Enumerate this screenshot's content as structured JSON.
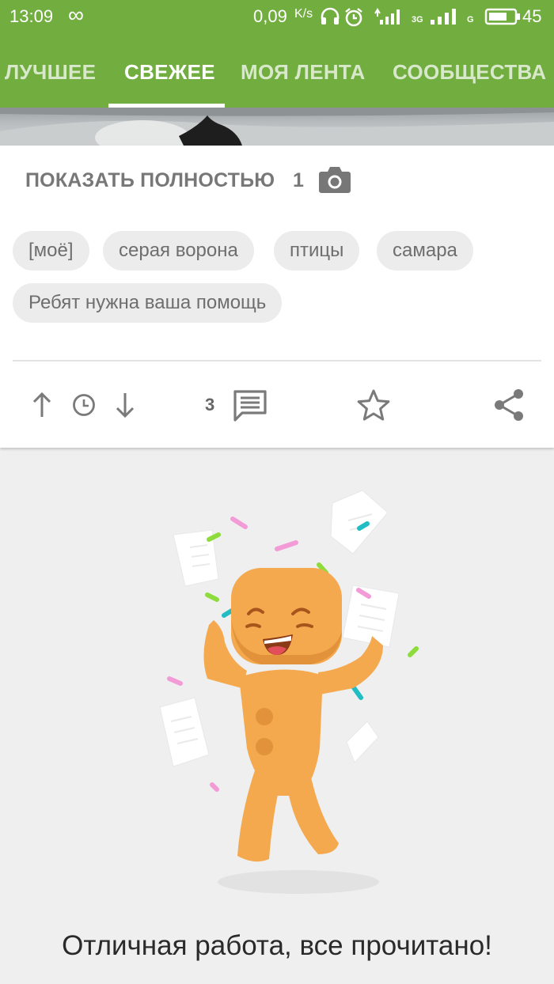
{
  "status_bar": {
    "time": "13:09",
    "loop_symbol": "∞",
    "net_speed": "0,09",
    "net_speed_unit": "K/s",
    "network_3g": "3G",
    "network_g": "G",
    "battery": "45"
  },
  "tabs": [
    {
      "label": "ЛУЧШЕЕ",
      "active": false
    },
    {
      "label": "СВЕЖЕЕ",
      "active": true
    },
    {
      "label": "МОЯ ЛЕНТА",
      "active": false
    },
    {
      "label": "СООБЩЕСТВА",
      "active": false
    }
  ],
  "post": {
    "show_full_label": "ПОКАЗАТЬ ПОЛНОСТЬЮ",
    "photo_count": "1",
    "tags": [
      "[моё]",
      "серая ворона",
      "птицы",
      "самара",
      "Ребят нужна ваша помощь"
    ],
    "comments_count": "3"
  },
  "empty_state": {
    "message": "Отличная работа, все прочитано!"
  },
  "colors": {
    "accent": "#72ad40",
    "mascot": "#f4a94e",
    "icon_gray": "#7a7a7a"
  }
}
